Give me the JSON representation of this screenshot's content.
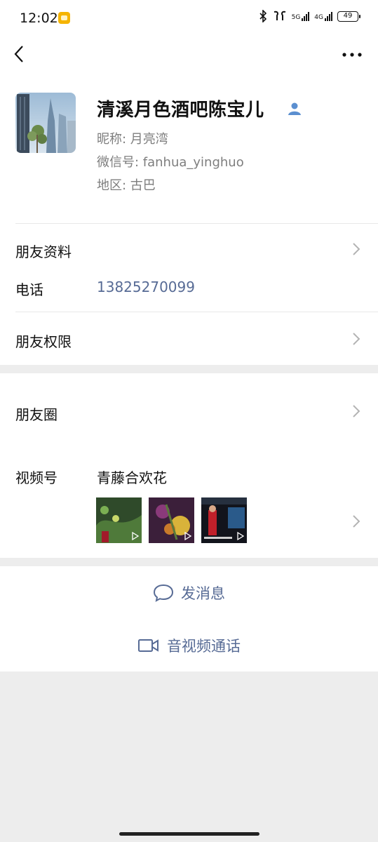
{
  "status_bar": {
    "time": "12:02",
    "network_5g": "5G",
    "network_4g": "4G",
    "battery": "49"
  },
  "profile": {
    "name": "清溪月色酒吧陈宝儿",
    "nickname": "昵称:  月亮湾",
    "wechat_id": "微信号:  fanhua_yinghuo",
    "region": "地区:  古巴"
  },
  "rows": {
    "friend_info": "朋友资料",
    "phone_label": "电话",
    "phone_value": "13825270099",
    "permissions": "朋友权限",
    "moments": "朋友圈",
    "channels_label": "视频号",
    "channels_value": "青藤合欢花"
  },
  "actions": {
    "message": "发消息",
    "call": "音视频通话"
  },
  "icons": {
    "back": "back-arrow-icon",
    "more": "more-dots-icon",
    "contact": "contact-person-icon",
    "chevron": "chevron-right-icon",
    "chat": "chat-bubble-icon",
    "video": "video-camera-icon"
  },
  "colors": {
    "link": "#576b95",
    "background": "#ededed",
    "card": "#ffffff"
  }
}
